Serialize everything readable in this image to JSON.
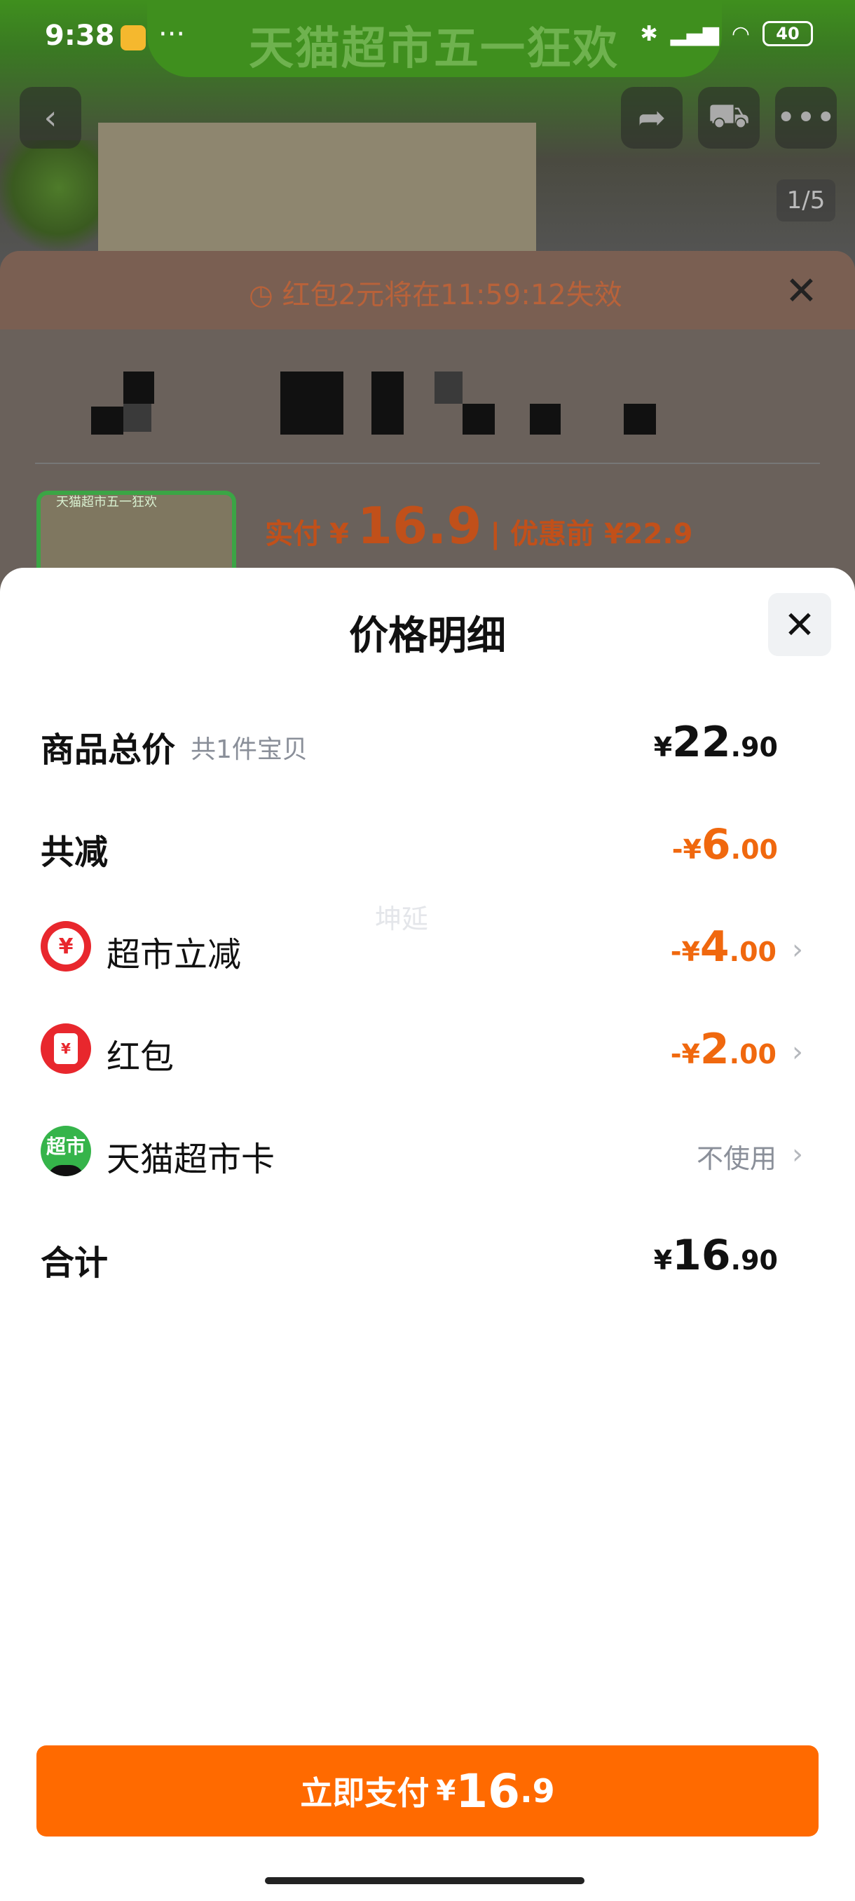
{
  "status_bar": {
    "time": "9:38",
    "dots": "···",
    "battery": "40"
  },
  "background": {
    "banner_text": "天猫超市五一狂欢",
    "page_indicator": "1/5",
    "thumb_text": "天猫超市五一狂欢",
    "coupon_text": "红包2元将在11:59:12失效",
    "paid_label": "实付",
    "paid_currency": "¥",
    "paid_value": "16.9",
    "before_label": "| 优惠前 ¥22.9"
  },
  "sheet": {
    "title": "价格明细",
    "watermark": "坤延",
    "rows": {
      "total": {
        "label": "商品总价",
        "sub": "共1件宝贝",
        "cur": "¥",
        "int": "22",
        "dec": ".90"
      },
      "discount": {
        "label": "共减",
        "cur": "-¥",
        "int": "6",
        "dec": ".00"
      },
      "market": {
        "label": "超市立减",
        "icon": "yen-coin-icon",
        "cur": "-¥",
        "int": "4",
        "dec": ".00"
      },
      "redpacket": {
        "label": "红包",
        "icon": "red-envelope-icon",
        "cur": "-¥",
        "int": "2",
        "dec": ".00"
      },
      "card": {
        "label": "天猫超市卡",
        "icon_text": "超市",
        "value": "不使用"
      },
      "sum": {
        "label": "合计",
        "cur": "¥",
        "int": "16",
        "dec": ".90"
      }
    },
    "pay_button": {
      "label": "立即支付",
      "cur": "¥",
      "int": "16",
      "dec": ".9"
    }
  },
  "colors": {
    "accent": "#ff6a00",
    "discount": "#f0680e",
    "icon_red": "#e8272d",
    "icon_green": "#35b44a"
  }
}
